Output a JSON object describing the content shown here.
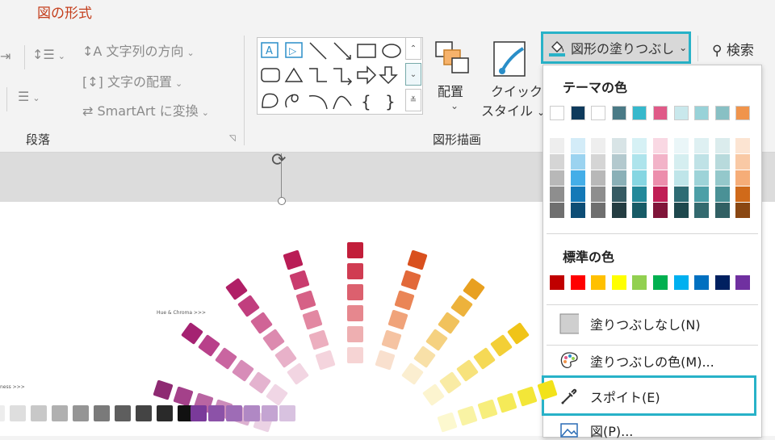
{
  "ribbon": {
    "tab": "図の形式",
    "text_direction": "文字列の方向",
    "align_text": "文字の配置",
    "smartart": "SmartArt に変換",
    "group_paragraph": "段落",
    "group_drawing": "図形描画",
    "arrange": "配置",
    "quick_style_1": "クイック",
    "quick_style_2": "スタイル",
    "fill_button": "図形の塗りつぶし",
    "search": "検索"
  },
  "menu": {
    "theme_colors_heading": "テーマの色",
    "standard_colors_heading": "標準の色",
    "no_fill": "塗りつぶしなし(N)",
    "more_colors": "塗りつぶしの色(M)...",
    "eyedropper": "スポイト(E)",
    "picture": "図(P)...",
    "theme_top_row": [
      "#ffffff",
      "#0e3a5c",
      "#ffffff",
      "#4a7a86",
      "#36b8cc",
      "#e05a88",
      "#c9e8ec",
      "#98d2d8",
      "#88c0c4",
      "#f0944c"
    ],
    "theme_shades": [
      [
        "#eeeeee",
        "#d3ecf8",
        "#eeeeee",
        "#d8e4e6",
        "#d6f1f5",
        "#f9d8e3",
        "#eaf6f8",
        "#def0f2",
        "#dbeced",
        "#fce4d2"
      ],
      [
        "#d5d5d5",
        "#9bd3f0",
        "#d5d5d5",
        "#b3c9ce",
        "#aee4ec",
        "#f2b3c8",
        "#d5eef0",
        "#bfe2e6",
        "#b8dadc",
        "#f9c9a5"
      ],
      [
        "#b8b8b8",
        "#44aee8",
        "#b8b8b8",
        "#8ab0b7",
        "#86d6e2",
        "#ec8eac",
        "#bfe5e9",
        "#9dd3d8",
        "#94c8cb",
        "#f6ad78"
      ],
      [
        "#8e8e8e",
        "#1479b7",
        "#8e8e8e",
        "#365b63",
        "#23899a",
        "#c01e55",
        "#2e6c74",
        "#4c9fa7",
        "#4a9196",
        "#d06a1a"
      ],
      [
        "#6f6f6f",
        "#0d4d75",
        "#6f6f6f",
        "#243d42",
        "#175b66",
        "#801439",
        "#1e484d",
        "#336a6f",
        "#316064",
        "#8a4712"
      ]
    ],
    "standard_row": [
      "#c00000",
      "#ff0000",
      "#ffc000",
      "#ffff00",
      "#92d050",
      "#00b050",
      "#00b0f0",
      "#0070c0",
      "#002060",
      "#7030a0"
    ]
  },
  "slide": {
    "hue_label": "Hue & Chroma >>>",
    "bright_label": "ness >>>"
  },
  "colors": {
    "accent": "#28b2c8",
    "tab_red": "#c43e1c"
  }
}
